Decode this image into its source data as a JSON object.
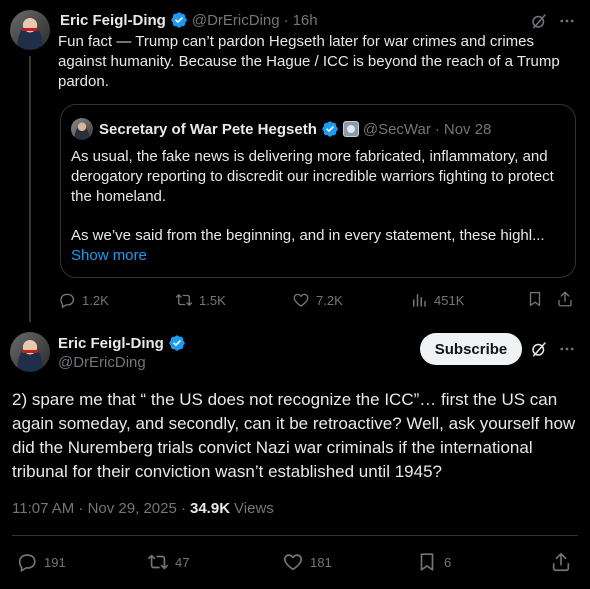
{
  "first_post": {
    "author_name": "Eric Feigl-Ding",
    "handle": "@DrEricDing",
    "separator": "·",
    "time": "16h",
    "text": "Fun fact — Trump can’t pardon Hegseth later for war crimes and crimes against humanity. Because the Hague / ICC is beyond the reach of a Trump pardon.",
    "quote": {
      "author_name": "Secretary of War Pete Hegseth",
      "handle": "@SecWar",
      "separator": "·",
      "date": "Nov 28",
      "paragraph1": "As usual, the fake news is delivering more fabricated, inflammatory, and derogatory reporting to discredit our incredible warriors fighting to protect the homeland.",
      "paragraph2": "As we’ve said from the beginning, and in every statement, these highl...",
      "show_more": "Show more"
    },
    "stats": {
      "replies": "1.2K",
      "reposts": "1.5K",
      "likes": "7.2K",
      "views": "451K"
    }
  },
  "main_post": {
    "author_name": "Eric Feigl-Ding",
    "handle": "@DrEricDing",
    "subscribe_label": "Subscribe",
    "text": "2) spare me that “ the US does not recognize the ICC”… first the US can again someday, and secondly, can it be retroactive? Well, ask yourself how did the Nuremberg trials convict Nazi war criminals if the international tribunal for their conviction wasn’t established until 1945?",
    "timestamp": "11:07 AM · Nov 29, 2025 ·",
    "views_count": "34.9K",
    "views_label": "Views",
    "stats": {
      "replies": "191",
      "reposts": "47",
      "likes": "181",
      "bookmarks": "6"
    }
  },
  "colors": {
    "background": "#000000",
    "text": "#e7e9ea",
    "muted": "#71767b",
    "link": "#1d9bf0",
    "verified": "#1d9bf0",
    "border": "#2f3336"
  },
  "icons": [
    "verified-badge-icon",
    "grok-icon",
    "more-icon",
    "reply-icon",
    "repost-icon",
    "like-icon",
    "views-icon",
    "bookmark-icon",
    "share-icon",
    "government-badge-icon"
  ]
}
